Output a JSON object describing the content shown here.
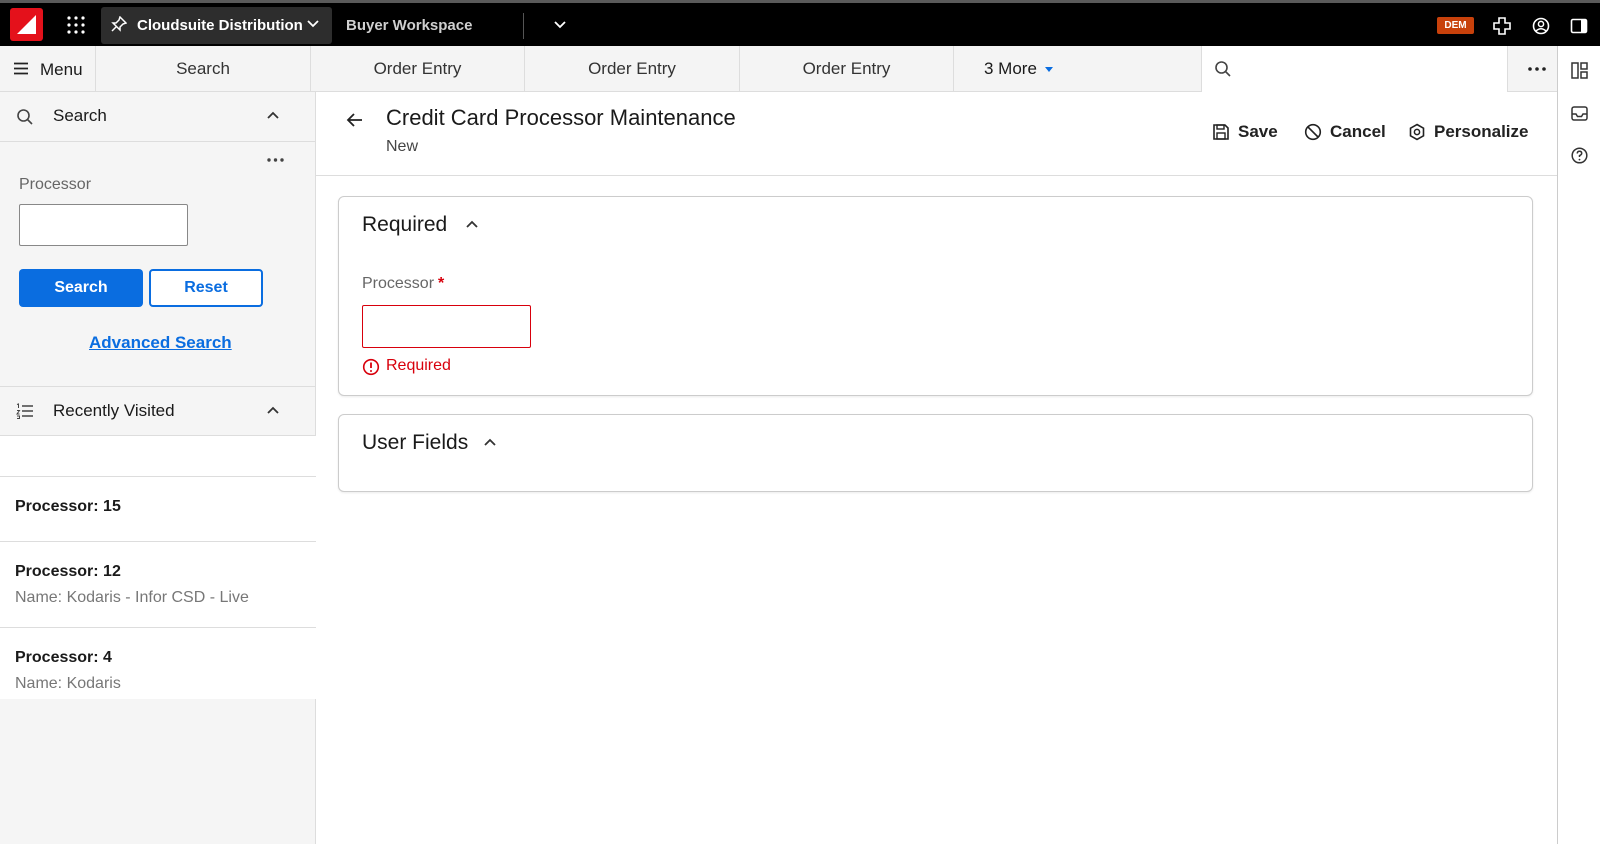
{
  "app": {
    "name": "Cloudsuite Distribution",
    "workspace": "Buyer Workspace",
    "env_badge": "DEM"
  },
  "tabs": {
    "menu_label": "Menu",
    "items": [
      "Search",
      "Order Entry",
      "Order Entry",
      "Order Entry"
    ],
    "more_label": "3 More",
    "search_placeholder": ""
  },
  "search_panel": {
    "title": "Search",
    "field_label": "Processor",
    "field_value": "",
    "search_button": "Search",
    "reset_button": "Reset",
    "advanced_link": "Advanced Search"
  },
  "recently_visited": {
    "title": "Recently Visited",
    "items": [
      {
        "title": "Processor: 15",
        "subtitle": ""
      },
      {
        "title": "Processor: 12",
        "subtitle": "Name: Kodaris - Infor CSD - Live"
      },
      {
        "title": "Processor: 4",
        "subtitle": "Name: Kodaris"
      }
    ]
  },
  "page": {
    "title": "Credit Card Processor Maintenance",
    "subtitle": "New",
    "actions": {
      "save": "Save",
      "cancel": "Cancel",
      "personalize": "Personalize"
    }
  },
  "sections": {
    "required": {
      "title": "Required",
      "field_label": "Processor",
      "required_marker": "*",
      "field_value": "",
      "error_text": "Required"
    },
    "user_fields": {
      "title": "User Fields"
    }
  },
  "colors": {
    "brand_red": "#e4111b",
    "primary_blue": "#0a6de0",
    "error_red": "#d8000c",
    "badge_orange": "#c8410b"
  }
}
